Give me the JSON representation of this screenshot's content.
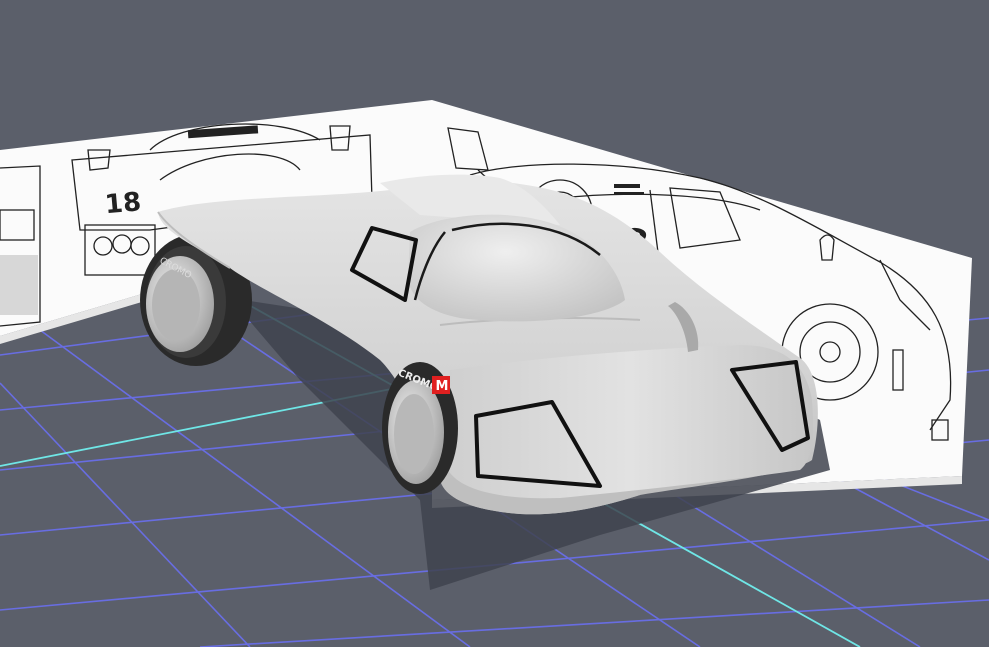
{
  "viewport": {
    "background_color": "#5b5f6a",
    "grid_color": "#6a6ff0",
    "axis_color": "#6fe6e6",
    "model_color": "#d9d9d9"
  },
  "decals": {
    "race_number": "18",
    "tire_brand": "CROMO",
    "brand_badge": "M",
    "badge_color": "#e02020"
  }
}
